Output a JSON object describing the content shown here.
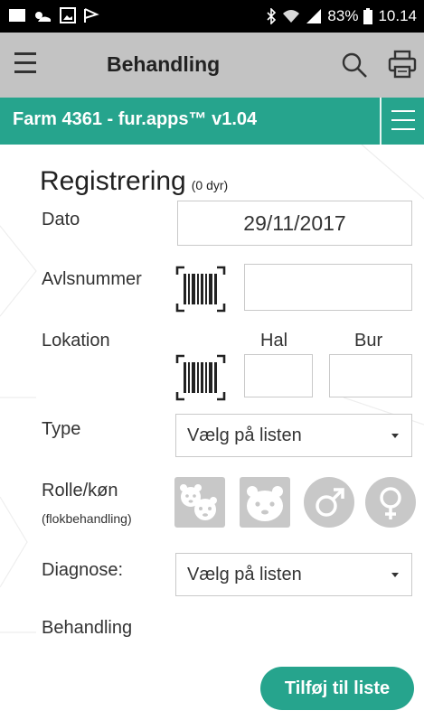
{
  "status_bar": {
    "battery": "83%",
    "time": "10.14"
  },
  "app_bar": {
    "title": "Behandling"
  },
  "teal_bar": {
    "farm_label": "Farm 4361 - fur.apps™ v1.04"
  },
  "form": {
    "heading": "Registrering",
    "heading_count": "(0 dyr)",
    "dato_label": "Dato",
    "dato_value": "29/11/2017",
    "avlsnummer_label": "Avlsnummer",
    "lokation_label": "Lokation",
    "hal_label": "Hal",
    "bur_label": "Bur",
    "type_label": "Type",
    "type_value": "Vælg på listen",
    "rolle_label": "Rolle/køn",
    "rolle_sub": "(flokbehandling)",
    "diagnose_label": "Diagnose:",
    "diagnose_value": "Vælg på listen",
    "behandling_label": "Behandling",
    "add_button": "Tilføj til liste"
  },
  "colors": {
    "accent": "#26a48d",
    "app_bar": "#c3c3c3",
    "status_bar": "#000000",
    "role_icon": "#c8c8c8"
  }
}
